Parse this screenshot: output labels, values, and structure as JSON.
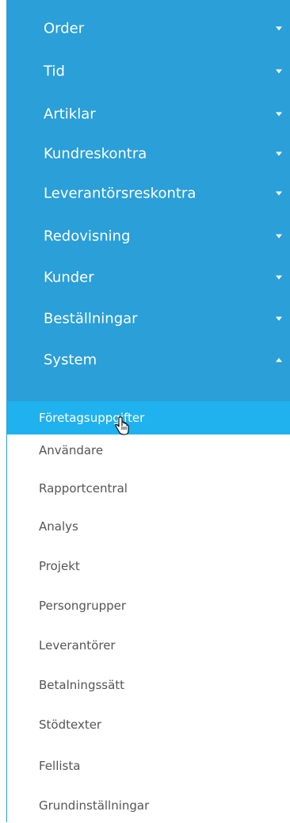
{
  "menu": {
    "items": [
      {
        "label": "Order",
        "expanded": false
      },
      {
        "label": "Tid",
        "expanded": false
      },
      {
        "label": "Artiklar",
        "expanded": false
      },
      {
        "label": "Kundreskontra",
        "expanded": false
      },
      {
        "label": "Leverantörsreskontra",
        "expanded": false
      },
      {
        "label": "Redovisning",
        "expanded": false
      },
      {
        "label": "Kunder",
        "expanded": false
      },
      {
        "label": "Beställningar",
        "expanded": false
      },
      {
        "label": "System",
        "expanded": true
      }
    ]
  },
  "submenu": {
    "items": [
      {
        "label": "Företagsuppgifter",
        "active": true
      },
      {
        "label": "Användare",
        "active": false
      },
      {
        "label": "Rapportcentral",
        "active": false
      },
      {
        "label": "Analys",
        "active": false
      },
      {
        "label": "Projekt",
        "active": false
      },
      {
        "label": "Persongrupper",
        "active": false
      },
      {
        "label": "Leverantörer",
        "active": false
      },
      {
        "label": "Betalningssätt",
        "active": false
      },
      {
        "label": "Stödtexter",
        "active": false
      },
      {
        "label": "Fellista",
        "active": false
      },
      {
        "label": "Grundinställningar",
        "active": false
      }
    ]
  },
  "colors": {
    "menu_bg": "#2a9fd8",
    "active_bg": "#1fb2ee",
    "submenu_text": "#555555"
  },
  "icons": {
    "collapsed": "caret-down-icon",
    "expanded": "caret-up-icon",
    "cursor": "hand-pointer-icon"
  }
}
